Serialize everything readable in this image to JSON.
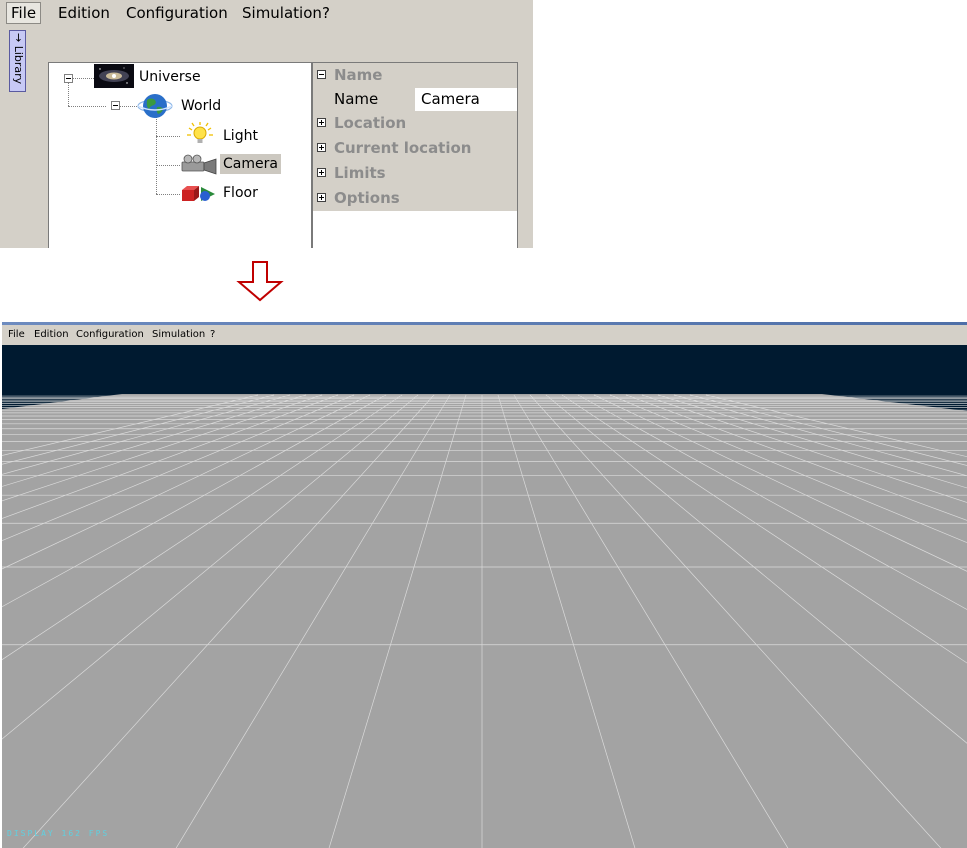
{
  "editor": {
    "menu": [
      {
        "label": "File",
        "active": true
      },
      {
        "label": "Edition",
        "active": false
      },
      {
        "label": "Configuration",
        "active": false
      },
      {
        "label": "Simulation",
        "active": false
      },
      {
        "label": "?",
        "active": false
      }
    ],
    "library_tab": "→ Library",
    "tree": {
      "universe": "Universe",
      "world": "World",
      "light": "Light",
      "camera": "Camera",
      "floor": "Floor"
    },
    "properties": {
      "groups": [
        "Name",
        "Location",
        "Current location",
        "Limits",
        "Options"
      ],
      "name_row": {
        "key": "Name",
        "value": "Camera"
      }
    }
  },
  "view": {
    "menu": [
      "File",
      "Edition",
      "Configuration",
      "Simulation",
      "?"
    ],
    "fps_text": "DISPLAY 162 FPS",
    "colors": {
      "sky": "#001a30",
      "floor": "#a3a3a3",
      "grid": "#e4e4e4",
      "fps": "#5fd0e0",
      "arrow": "#c00000"
    }
  }
}
